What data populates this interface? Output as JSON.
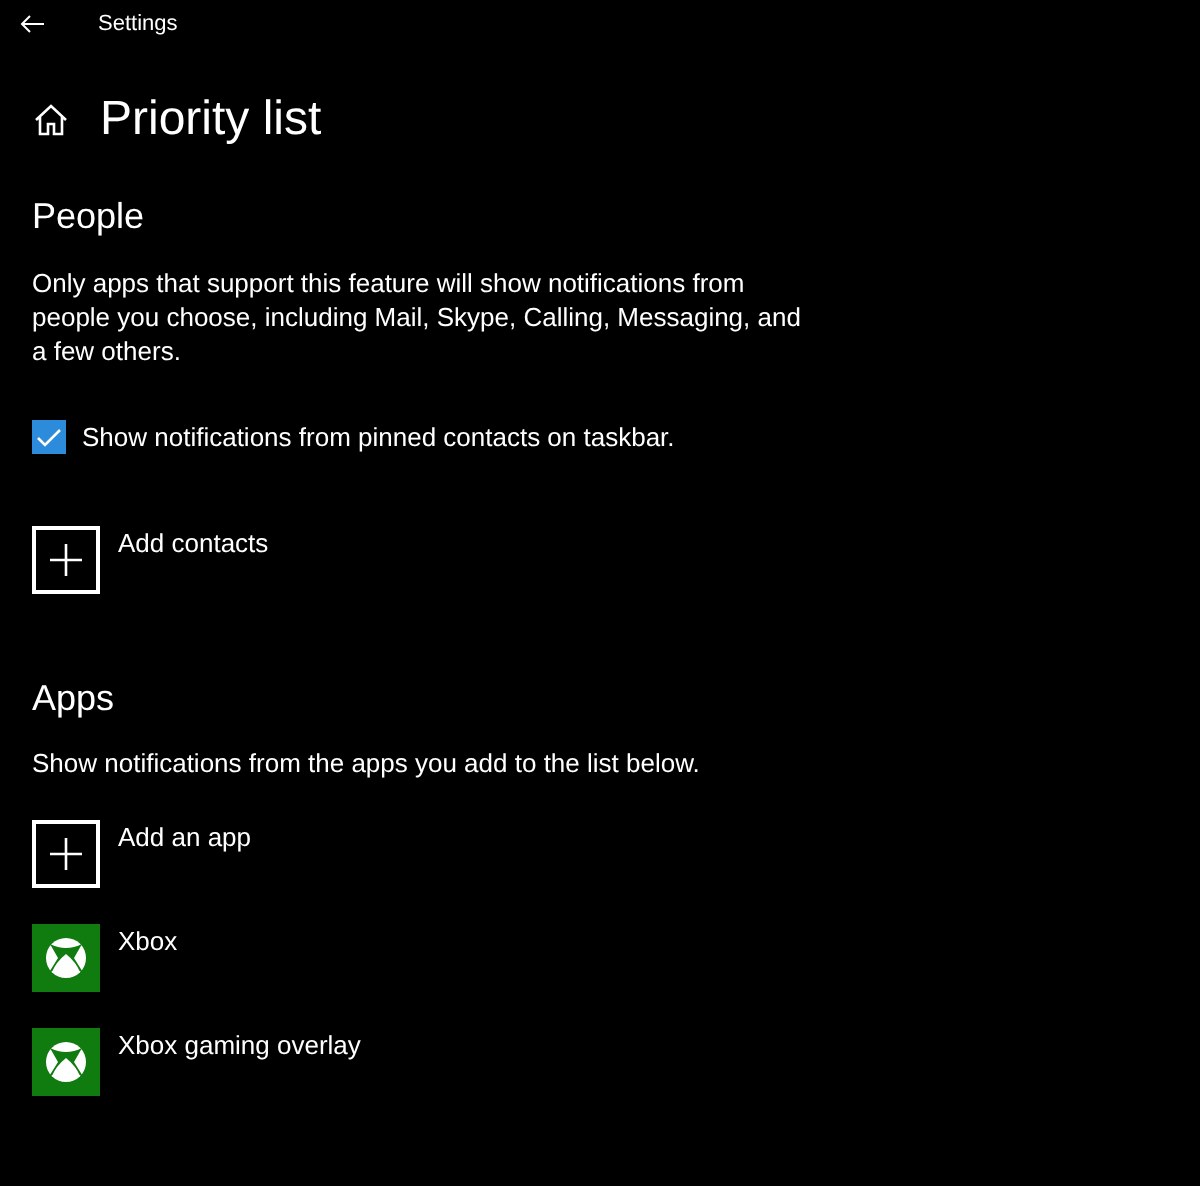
{
  "window": {
    "title": "Settings"
  },
  "page": {
    "title": "Priority list"
  },
  "people": {
    "heading": "People",
    "description": "Only apps that support this feature will show notifications from people you choose, including Mail, Skype, Calling, Messaging, and a few others.",
    "checkbox": {
      "label": "Show notifications from pinned contacts on taskbar.",
      "checked": true
    },
    "items": [
      {
        "kind": "add",
        "label": "Add contacts"
      }
    ]
  },
  "apps": {
    "heading": "Apps",
    "description": "Show notifications from the apps you add to the list below.",
    "items": [
      {
        "kind": "add",
        "label": "Add an app"
      },
      {
        "kind": "app",
        "label": "Xbox"
      },
      {
        "kind": "app",
        "label": "Xbox gaming overlay"
      }
    ]
  }
}
